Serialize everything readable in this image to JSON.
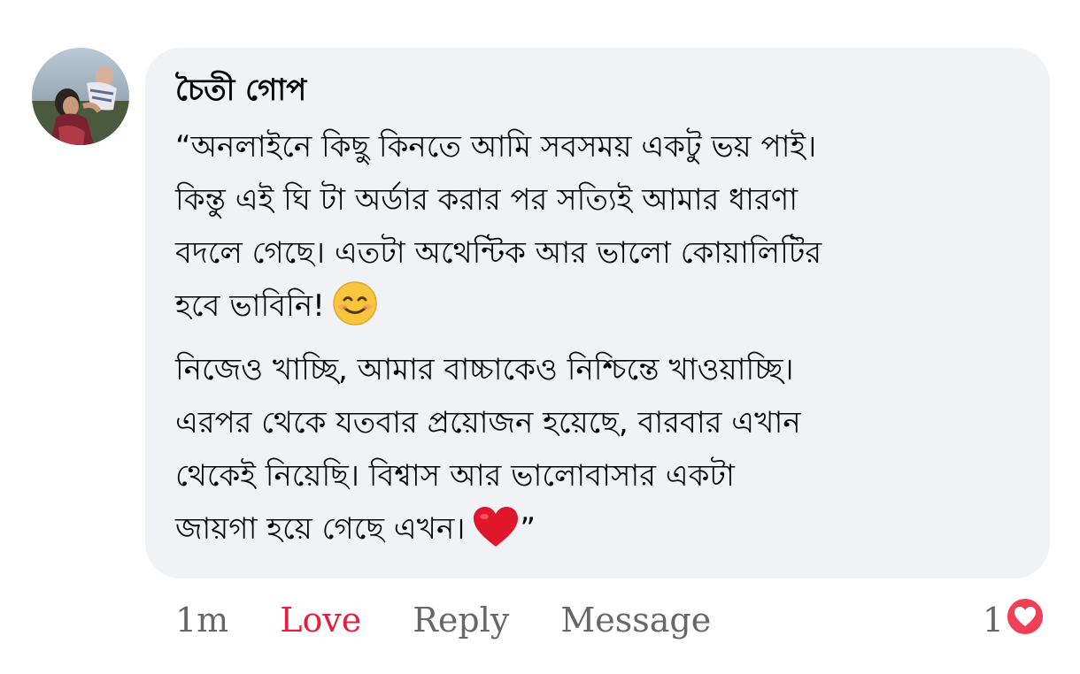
{
  "comment": {
    "author": "চৈতী গোপ",
    "lines": [
      "“অনলাইনে কিছু কিনতে আমি সবসময় একটু ভয় পাই।",
      "কিন্তু এই ঘি টা অর্ডার করার পর সত্যিই আমার ধারণা",
      "বদলে গেছে। এতটা অথেন্টিক আর ভালো কোয়ালিটির",
      "হবে ভাবিনি!",
      "নিজেও খাচ্ছি, আমার বাচ্চাকেও নিশ্চিন্তে খাওয়াচ্ছি।",
      "এরপর থেকে যতবার প্রয়োজন হয়েছে, বারবার এখান",
      "থেকেই নিয়েছি। বিশ্বাস আর ভালোবাসার একটা",
      "জায়গা হয়ে গেছে এখন।",
      "”"
    ]
  },
  "actions": {
    "time": "1m",
    "love": "Love",
    "reply": "Reply",
    "message": "Message"
  },
  "reactions": {
    "count": "1",
    "icon": "heart-reaction-icon"
  },
  "colors": {
    "bubble": "#f0f2f5",
    "love": "#e41e3f",
    "meta": "#65676b"
  }
}
